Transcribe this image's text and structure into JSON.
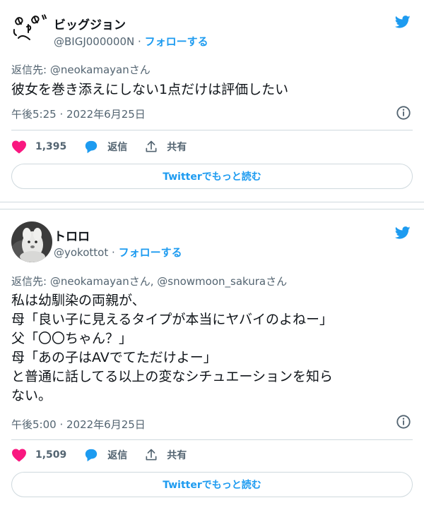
{
  "colors": {
    "accent": "#1d9bf0",
    "like": "#f91880",
    "muted": "#536471",
    "text": "#0f1419"
  },
  "tweets": [
    {
      "author_name": "ビッグジョン",
      "handle": "@BIGJ000000N",
      "separator": "·",
      "follow_label": "フォローする",
      "reply_to_prefix": "返信先: ",
      "reply_to_handles": "@neokamayanさん",
      "text_lines": [
        "彼女を巻き添えにしない1点だけは評価したい"
      ],
      "timestamp": "午後5:25 · 2022年6月25日",
      "likes": "1,395",
      "reply_label": "返信",
      "share_label": "共有",
      "more_label": "Twitterでもっと読む",
      "icons": [
        "twitter-bird-icon",
        "info-icon",
        "heart-icon",
        "reply-bubble-icon",
        "share-icon"
      ]
    },
    {
      "author_name": "トロロ",
      "handle": "@yokottot",
      "separator": "·",
      "follow_label": "フォローする",
      "reply_to_prefix": "返信先: ",
      "reply_to_handles": "@neokamayanさん, @snowmoon_sakuraさん",
      "text_lines": [
        "私は幼馴染の両親が、",
        "母「良い子に見えるタイプが本当にヤバイのよねー」",
        "父「〇〇ちゃん？」",
        "母「あの子はAVでてただけよー」",
        "と普通に話してる以上の変なシチュエーションを知ら",
        "ない。"
      ],
      "timestamp": "午後5:00 · 2022年6月25日",
      "likes": "1,509",
      "reply_label": "返信",
      "share_label": "共有",
      "more_label": "Twitterでもっと読む",
      "icons": [
        "twitter-bird-icon",
        "info-icon",
        "heart-icon",
        "reply-bubble-icon",
        "share-icon"
      ]
    }
  ]
}
